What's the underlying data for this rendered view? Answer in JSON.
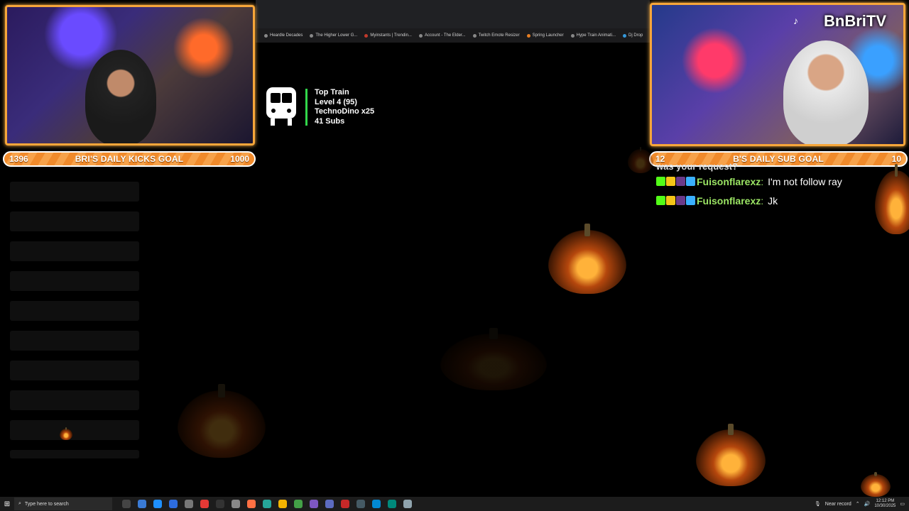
{
  "bookmarks": [
    "Heardle Decades",
    "The Higher Lower G...",
    "Myinstants | Trendin...",
    "Account - The Elder...",
    "Twitch Emote Resizer",
    "Spring Launcher",
    "Hype Train Animati...",
    "Dj Drop"
  ],
  "overlay": {
    "channel_name": "BnBriTV",
    "left_goal": {
      "current": "1396",
      "title": "BRI'S DAILY KICKS GOAL",
      "target": "1000"
    },
    "right_goal": {
      "current": "12",
      "title": "B'S DAILY SUB GOAL",
      "target": "10"
    },
    "train": {
      "title": "Top Train",
      "level": "Level 4  (95)",
      "top_user": "TechnoDino x25",
      "subs": "41 Subs"
    }
  },
  "chat": {
    "cut_line": "was your request?",
    "messages": [
      {
        "user": "Fuisonflarexz",
        "message": "I'm not follow ray"
      },
      {
        "user": "Fuisonflarexz",
        "message": "Jk"
      }
    ]
  },
  "taskbar": {
    "search_placeholder": "Type here to search",
    "tray_label": "Near record",
    "time": "12:12 PM",
    "date": "10/30/2025"
  },
  "colors": {
    "goal_orange": "#f08a2b",
    "cam_border": "#f6a63a",
    "chat_username": "#9be564",
    "train_accent": "#32d74b"
  }
}
